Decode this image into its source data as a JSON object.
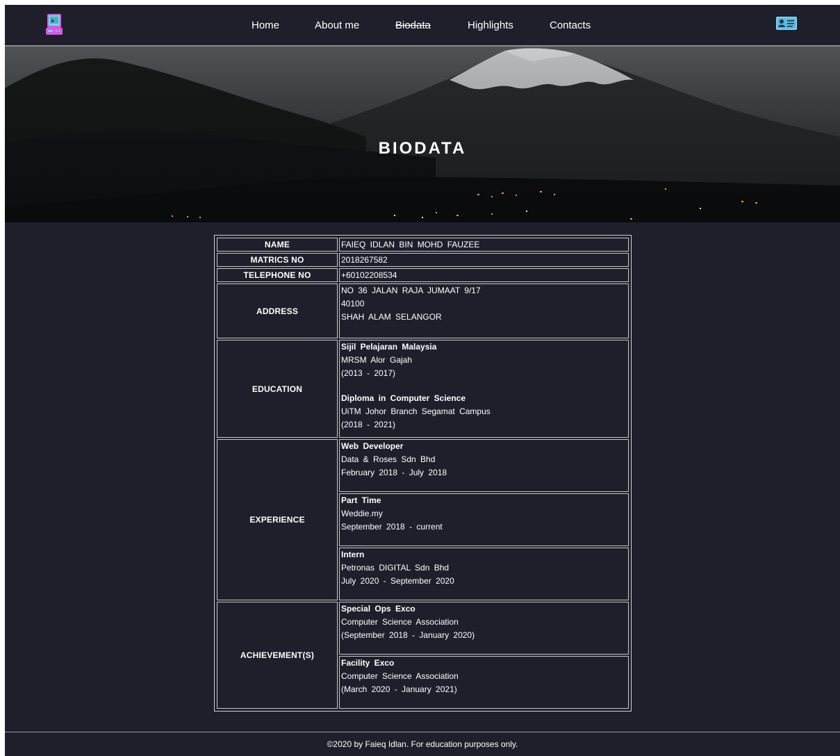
{
  "nav": {
    "links": [
      {
        "label": "Home"
      },
      {
        "label": "About me"
      },
      {
        "label": "Biodata"
      },
      {
        "label": "Highlights"
      },
      {
        "label": "Contacts"
      }
    ],
    "active_index": 2,
    "logo_icon": "retro-computer-icon",
    "right_icon": "id-card-icon"
  },
  "hero": {
    "title": "BIODATA"
  },
  "biodata": {
    "name_label": "NAME",
    "name_value": "FAIEQ IDLAN BIN MOHD FAUZEE",
    "matrics_label": "MATRICS NO",
    "matrics_value": "2018267582",
    "telephone_label": "TELEPHONE NO",
    "telephone_value": "+60102208534",
    "address_label": "ADDRESS",
    "address_lines": [
      "NO 36 JALAN RAJA JUMAAT 9/17",
      "40100",
      "SHAH ALAM SELANGOR"
    ],
    "education_label": "EDUCATION",
    "education": [
      {
        "title": "Sijil Pelajaran Malaysia",
        "place": "MRSM Alor Gajah",
        "period": "(2013 - 2017)"
      },
      {
        "title": "Diploma in Computer Science",
        "place": "UiTM Johor Branch Segamat Campus",
        "period": "(2018 - 2021)"
      }
    ],
    "experience_label": "EXPERIENCE",
    "experience": [
      {
        "title": "Web Developer",
        "place": "Data & Roses Sdn Bhd",
        "period": "February 2018 - July 2018"
      },
      {
        "title": "Part Time",
        "place": "Weddie.my",
        "period": "September 2018 - current"
      },
      {
        "title": "Intern",
        "place": "Petronas DIGITAL Sdn Bhd",
        "period": "July 2020 - September 2020"
      }
    ],
    "achievement_label": "ACHIEVEMENT(S)",
    "achievements": [
      {
        "title": "Special Ops Exco",
        "place": "Computer Science Association",
        "period": "(September 2018 - January 2020)"
      },
      {
        "title": "Facility Exco",
        "place": "Computer Science Association",
        "period": "(March 2020 - January 2021)"
      }
    ]
  },
  "footer": {
    "text": "©2020 by Faieq Idlan. For education purposes only."
  },
  "colors": {
    "page_bg": "#1f1f2c",
    "text": "#ffffff",
    "logo_accent": "#e052e8"
  }
}
